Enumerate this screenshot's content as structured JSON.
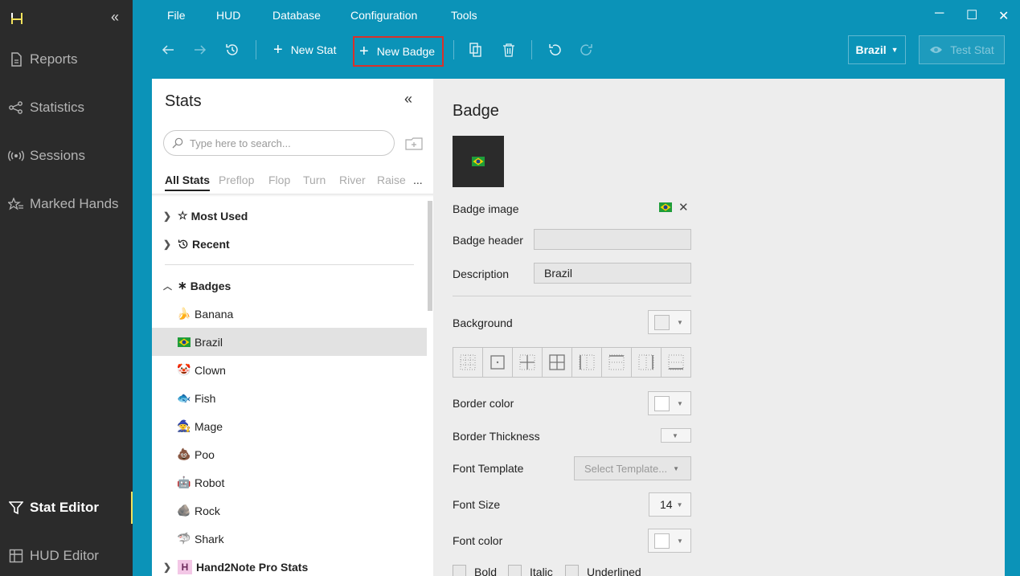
{
  "sidebar": {
    "collapse_glyph": "«",
    "items": [
      {
        "label": "Reports",
        "icon": "reports-icon"
      },
      {
        "label": "Statistics",
        "icon": "statistics-icon"
      },
      {
        "label": "Sessions",
        "icon": "sessions-icon"
      },
      {
        "label": "Marked Hands",
        "icon": "marked-hands-icon"
      },
      {
        "label": "Stat Editor",
        "icon": "filter-icon",
        "active": true
      },
      {
        "label": "HUD Editor",
        "icon": "hud-editor-icon"
      }
    ]
  },
  "menu": {
    "items": [
      "File",
      "HUD",
      "Database",
      "Configuration",
      "Tools"
    ]
  },
  "window_controls": {
    "minimize": "─",
    "maximize": "☐",
    "close": "✕"
  },
  "toolbar": {
    "new_stat_label": "New Stat",
    "new_badge_label": "New Badge",
    "plus": "+",
    "country_select": "Brazil",
    "test_stat_label": "Test Stat"
  },
  "stats_panel": {
    "title": "Stats",
    "collapse_glyph": "«",
    "search_placeholder": "Type here to search...",
    "tabs": [
      "All Stats",
      "Preflop",
      "Flop",
      "Turn",
      "River",
      "Raise",
      "..."
    ],
    "groups": {
      "most_used": "Most Used",
      "recent": "Recent",
      "badges": "Badges",
      "pro": "Hand2Note Pro Stats"
    },
    "badges": [
      {
        "emoji": "🍌",
        "label": "Banana"
      },
      {
        "emoji": "🇧🇷",
        "label": "Brazil",
        "selected": true
      },
      {
        "emoji": "🤡",
        "label": "Clown"
      },
      {
        "emoji": "🐟",
        "label": "Fish"
      },
      {
        "emoji": "🧙",
        "label": "Mage"
      },
      {
        "emoji": "💩",
        "label": "Poo"
      },
      {
        "emoji": "🤖",
        "label": "Robot"
      },
      {
        "emoji": "🪨",
        "label": "Rock"
      },
      {
        "emoji": "🦈",
        "label": "Shark"
      }
    ],
    "pro_badge_letter": "H"
  },
  "editor": {
    "title": "Badge",
    "preview_emoji": "🇧🇷",
    "labels": {
      "badge_image": "Badge image",
      "badge_header": "Badge header",
      "description": "Description",
      "background": "Background",
      "border_color": "Border color",
      "border_thickness": "Border Thickness",
      "font_template": "Font Template",
      "font_size": "Font Size",
      "font_color": "Font color"
    },
    "badge_image_emoji": "🇧🇷",
    "remove_glyph": "✕",
    "badge_header_value": "",
    "description_value": "Brazil",
    "font_template_placeholder": "Select Template...",
    "font_size_value": "14",
    "checkboxes": [
      "Bold",
      "Italic",
      "Underlined"
    ]
  },
  "colors": {
    "titlebar": "#0b93b8",
    "sidebar": "#2b2b2b",
    "active_indicator": "#f3e35c",
    "highlight_border": "#d9312a"
  }
}
